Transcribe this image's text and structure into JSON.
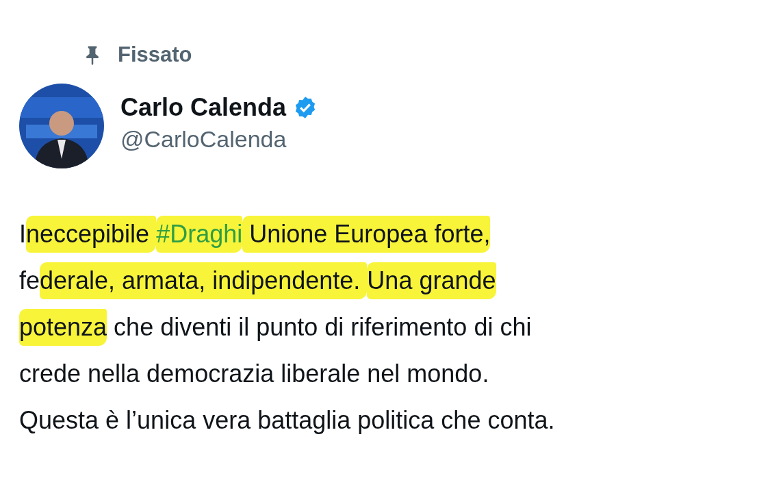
{
  "pinned_label": "Fissato",
  "author": {
    "name": "Carlo Calenda",
    "verified": true,
    "handle": "@CarloCalenda"
  },
  "tweet_lines": [
    [
      {
        "kind": "text",
        "text": "I",
        "highlighted": false
      },
      {
        "kind": "text",
        "text": "neccepibile ",
        "highlighted": true
      },
      {
        "kind": "hashtag",
        "text": "#Draghi",
        "highlighted": true
      },
      {
        "kind": "text",
        "text": " Unione Europea forte,",
        "highlighted": true
      }
    ],
    [
      {
        "kind": "text",
        "text": "fe",
        "highlighted": false
      },
      {
        "kind": "text",
        "text": "derale, armata, indipendente. ",
        "highlighted": true
      },
      {
        "kind": "text",
        "text": "Una grande",
        "highlighted": true
      }
    ],
    [
      {
        "kind": "text",
        "text": "potenza",
        "highlighted": true
      },
      {
        "kind": "text",
        "text": " che diventi il punto di riferimento di chi",
        "highlighted": false
      }
    ],
    [
      {
        "kind": "text",
        "text": "crede nella democrazia liberale nel mondo.",
        "highlighted": false
      }
    ],
    [
      {
        "kind": "text",
        "text": "Questa è l’unica vera battaglia politica che conta.",
        "highlighted": false
      }
    ]
  ]
}
